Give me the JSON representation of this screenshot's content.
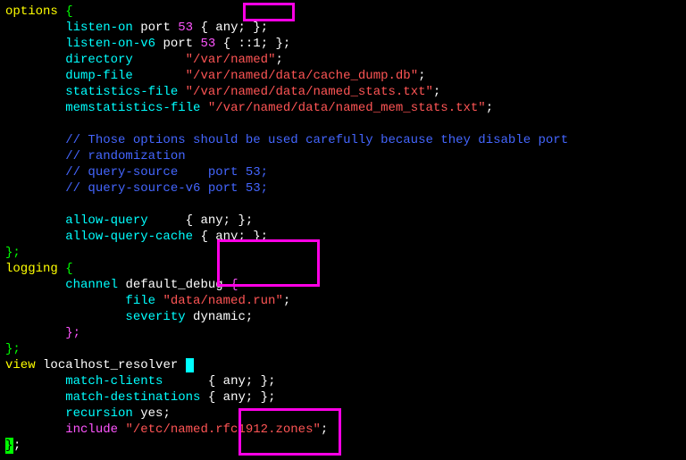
{
  "options": {
    "keyword": "options",
    "brace_open": "{",
    "listen_on_kw": "listen-on",
    "port_kw": "port",
    "port53": "53",
    "any_block": "{ any; }",
    "semi": ";",
    "listen_on_v6_kw": "listen-on-v6",
    "v6_block": "{ ::1; }",
    "directory_kw": "directory",
    "directory_val": "\"/var/named\"",
    "dump_file_kw": "dump-file",
    "dump_file_val": "\"/var/named/data/cache_dump.db\"",
    "stats_file_kw": "statistics-file",
    "stats_file_val": "\"/var/named/data/named_stats.txt\"",
    "memstats_kw": "memstatistics-file",
    "memstats_val": "\"/var/named/data/named_mem_stats.txt\"",
    "comment1": "// Those options should be used carefully because they disable port",
    "comment2": "// randomization",
    "comment3": "// query-source    port 53;",
    "comment4": "// query-source-v6 port 53;",
    "allow_query_kw": "allow-query",
    "allow_query_cache_kw": "allow-query-cache",
    "brace_close_semi": "};"
  },
  "logging": {
    "keyword": "logging",
    "brace_open": "{",
    "channel_kw": "channel",
    "channel_name": "default_debug",
    "brace_open2": "{",
    "file_kw": "file",
    "file_val": "\"data/named.run\"",
    "severity_kw": "severity",
    "severity_val": "dynamic",
    "brace_close_inner": "};",
    "brace_close_semi": "};"
  },
  "view": {
    "keyword": "view",
    "name": "localhost_resolver",
    "match_clients_kw": "match-clients",
    "match_dest_kw": "match-destinations",
    "any_block": "{ any; }",
    "recursion_kw": "recursion",
    "recursion_val": "yes",
    "include_kw": "include",
    "include_val": "\"/etc/named.rfc1912.zones\"",
    "semi": ";"
  },
  "closing_brace": "}"
}
